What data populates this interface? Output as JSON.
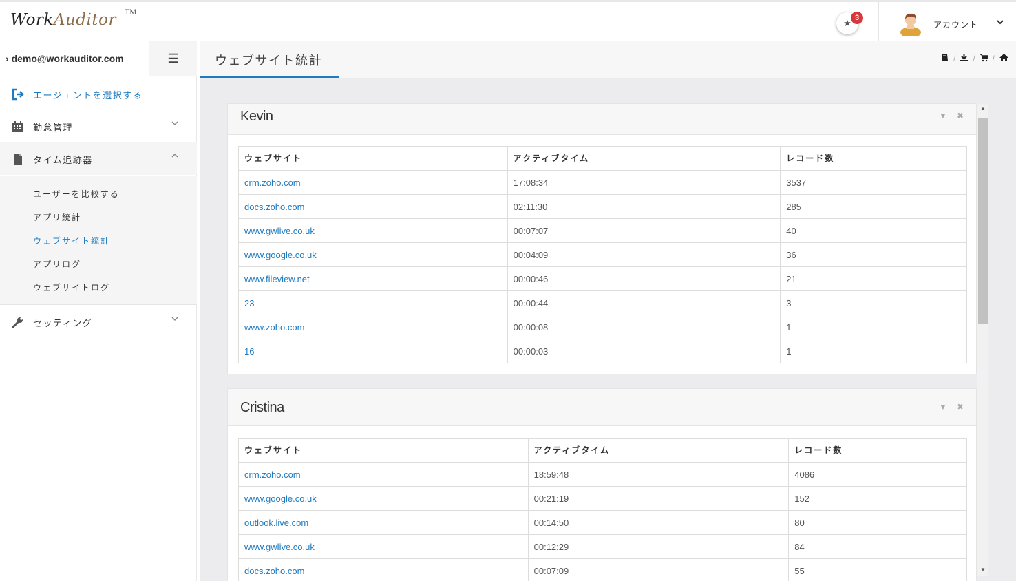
{
  "header": {
    "logo_work": "Work",
    "logo_auditor": "Auditor",
    "logo_tm": "TM",
    "notification_count": "3",
    "account_label": "アカウント"
  },
  "sidebar": {
    "user_email": "demo@workauditor.com",
    "items": [
      {
        "label": "エージェントを選択する",
        "icon": "sign-out-icon"
      },
      {
        "label": "勤怠管理",
        "icon": "calendar-icon"
      },
      {
        "label": "タイム追跡器",
        "icon": "file-icon"
      },
      {
        "label": "セッティング",
        "icon": "wrench-icon"
      }
    ],
    "submenu": [
      {
        "label": "ユーザーを比較する"
      },
      {
        "label": "アプリ統計"
      },
      {
        "label": "ウェブサイト統計"
      },
      {
        "label": "アプリログ"
      },
      {
        "label": "ウェブサイトログ"
      }
    ]
  },
  "page": {
    "title": "ウェブサイト統計"
  },
  "colors": {
    "accent": "#1f7abf",
    "badge": "#d9383a"
  },
  "tables": [
    {
      "name": "Kevin",
      "headers": [
        "ウェブサイト",
        "アクティブタイム",
        "レコード数"
      ],
      "rows": [
        [
          "crm.zoho.com",
          "17:08:34",
          "3537"
        ],
        [
          "docs.zoho.com",
          "02:11:30",
          "285"
        ],
        [
          "www.gwlive.co.uk",
          "00:07:07",
          "40"
        ],
        [
          "www.google.co.uk",
          "00:04:09",
          "36"
        ],
        [
          "www.fileview.net",
          "00:00:46",
          "21"
        ],
        [
          "23",
          "00:00:44",
          "3"
        ],
        [
          "www.zoho.com",
          "00:00:08",
          "1"
        ],
        [
          "16",
          "00:00:03",
          "1"
        ]
      ]
    },
    {
      "name": "Cristina",
      "headers": [
        "ウェブサイト",
        "アクティブタイム",
        "レコード数"
      ],
      "rows": [
        [
          "crm.zoho.com",
          "18:59:48",
          "4086"
        ],
        [
          "www.google.co.uk",
          "00:21:19",
          "152"
        ],
        [
          "outlook.live.com",
          "00:14:50",
          "80"
        ],
        [
          "www.gwlive.co.uk",
          "00:12:29",
          "84"
        ],
        [
          "docs.zoho.com",
          "00:07:09",
          "55"
        ]
      ]
    }
  ]
}
